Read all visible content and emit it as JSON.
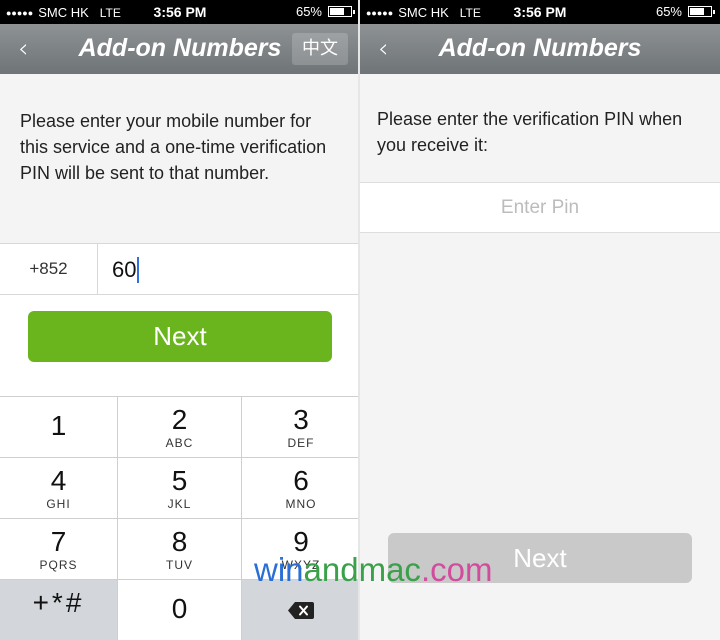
{
  "status_bar": {
    "signal": "●●●●●",
    "carrier": "SMC HK",
    "network": "LTE",
    "time": "3:56 PM",
    "battery_percent": "65%",
    "battery_level": 0.65
  },
  "left_screen": {
    "back_label": "‹",
    "title": "Add-on Numbers",
    "language_button": "中文",
    "instruction": "Please enter your mobile number for this service and a one-time verification PIN will be sent to that number.",
    "country_code": "+852",
    "phone_value": "60",
    "next_label": "Next",
    "keypad": [
      {
        "num": "1",
        "letters": ""
      },
      {
        "num": "2",
        "letters": "ABC"
      },
      {
        "num": "3",
        "letters": "DEF"
      },
      {
        "num": "4",
        "letters": "GHI"
      },
      {
        "num": "5",
        "letters": "JKL"
      },
      {
        "num": "6",
        "letters": "MNO"
      },
      {
        "num": "7",
        "letters": "PQRS"
      },
      {
        "num": "8",
        "letters": "TUV"
      },
      {
        "num": "9",
        "letters": "WXYZ"
      },
      {
        "num": "+*#",
        "letters": ""
      },
      {
        "num": "0",
        "letters": ""
      },
      {
        "num": "",
        "letters": ""
      }
    ]
  },
  "right_screen": {
    "back_label": "‹",
    "title": "Add-on Numbers",
    "instruction": "Please enter the verification PIN when you receive it:",
    "pin_placeholder": "Enter Pin",
    "next_label": "Next"
  },
  "watermark": {
    "part1": "win",
    "part2": "andmac",
    "part3": ".com"
  },
  "colors": {
    "next_enabled": "#6ab51e",
    "next_disabled": "#c9c9c9",
    "navbar": "#7d8285"
  }
}
